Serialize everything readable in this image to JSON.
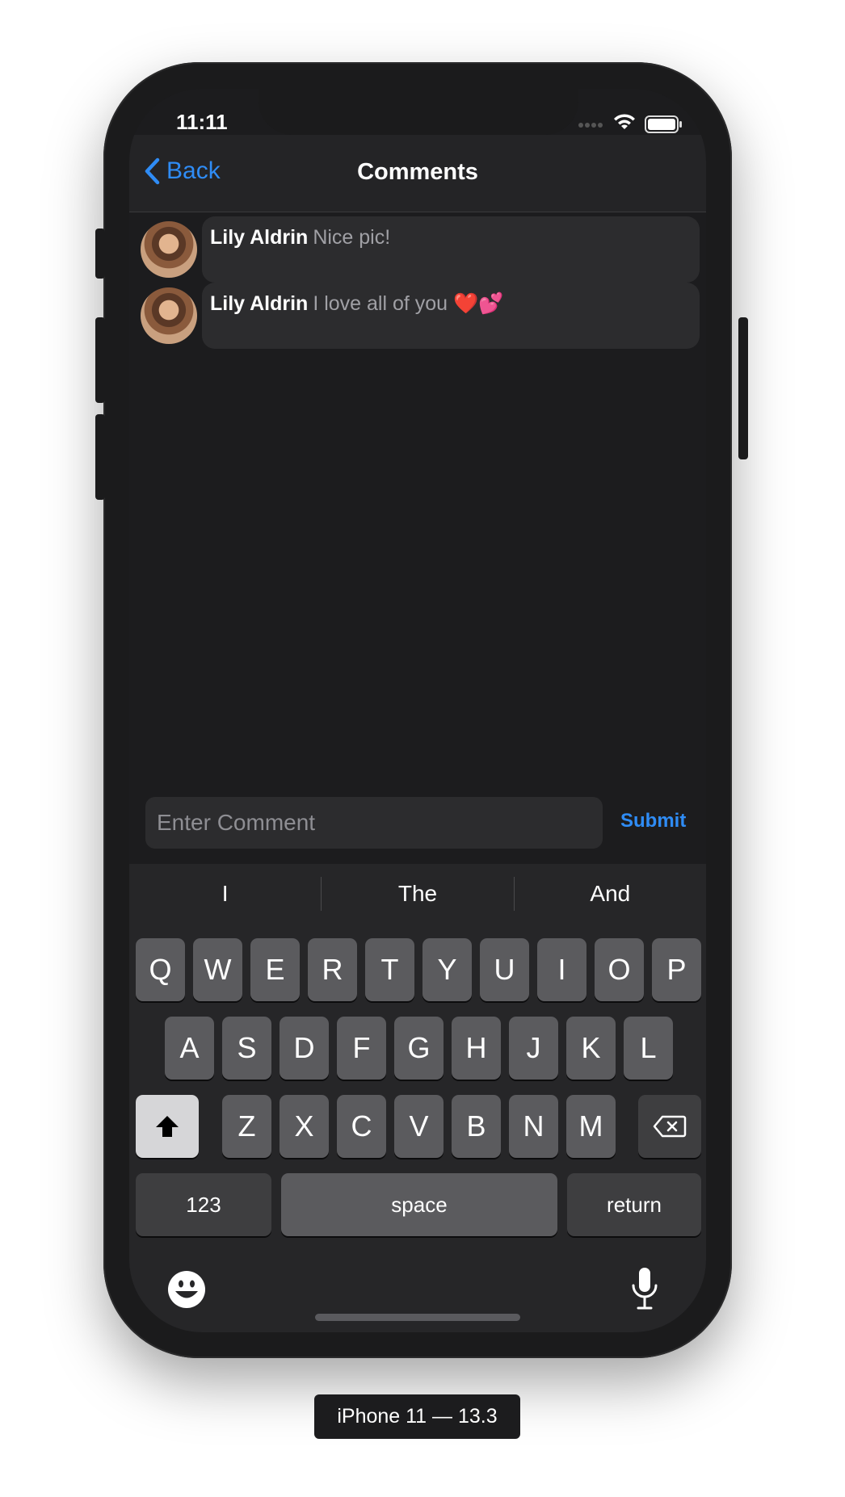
{
  "status": {
    "time": "11:11"
  },
  "nav": {
    "back_label": "Back",
    "title": "Comments"
  },
  "comments": [
    {
      "author": "Lily Aldrin",
      "text": "Nice pic!"
    },
    {
      "author": "Lily Aldrin",
      "text": "I love all of you ❤️💕"
    }
  ],
  "input": {
    "placeholder": "Enter Comment",
    "submit_label": "Submit"
  },
  "keyboard": {
    "suggestions": [
      "I",
      "The",
      "And"
    ],
    "row1": [
      "Q",
      "W",
      "E",
      "R",
      "T",
      "Y",
      "U",
      "I",
      "O",
      "P"
    ],
    "row2": [
      "A",
      "S",
      "D",
      "F",
      "G",
      "H",
      "J",
      "K",
      "L"
    ],
    "row3": [
      "Z",
      "X",
      "C",
      "V",
      "B",
      "N",
      "M"
    ],
    "numbers_label": "123",
    "space_label": "space",
    "return_label": "return",
    "icons": {
      "shift": "shift-icon",
      "delete": "delete-icon",
      "emoji": "emoji-icon",
      "mic": "microphone-icon"
    }
  },
  "device_label": "iPhone 11 — 13.3",
  "colors": {
    "accent": "#2f8cf5",
    "background": "#1c1c1e",
    "bubble": "#2c2c2e"
  }
}
